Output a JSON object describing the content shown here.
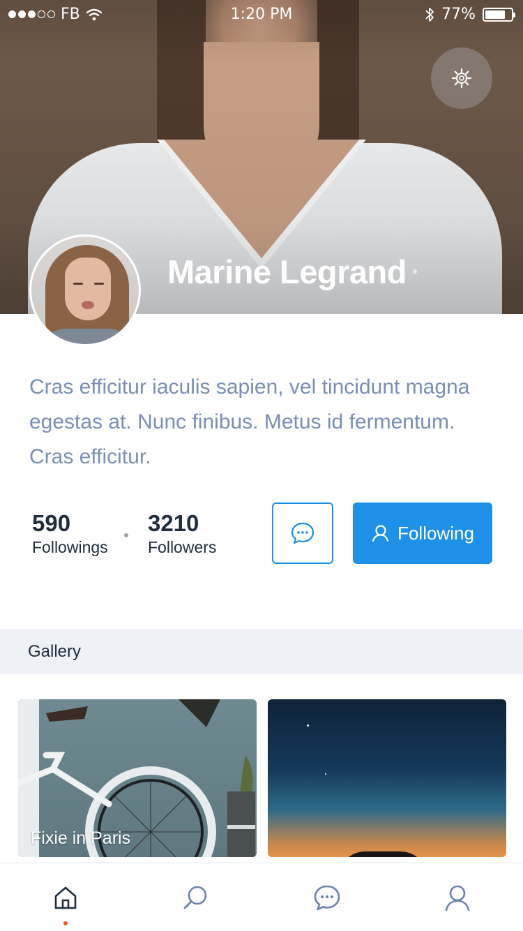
{
  "status_bar": {
    "carrier": "FB",
    "time": "1:20 PM",
    "battery": "77%",
    "battery_level": 0.77
  },
  "profile": {
    "name": "Marine Legrand",
    "bio": "Cras efficitur iaculis sapien, vel tincidunt magna egestas at. Nunc finibus. Metus id fermentum. Cras efficitur."
  },
  "stats": {
    "followings_count": "590",
    "followings_label": "Followings",
    "followers_count": "3210",
    "followers_label": "Followers"
  },
  "actions": {
    "follow_label": "Following"
  },
  "gallery": {
    "title": "Gallery",
    "items": [
      {
        "caption": "Fixie in Paris"
      },
      {
        "caption": ""
      }
    ]
  },
  "tabbar": {
    "items": [
      "home-icon",
      "search-icon",
      "chat-icon",
      "user-icon"
    ],
    "active": "home-icon"
  },
  "colors": {
    "accent": "#1e90e8",
    "bio_text": "#7a8fb4",
    "active_dot": "#f05a28",
    "gallery_header_bg": "#eef1f5"
  }
}
